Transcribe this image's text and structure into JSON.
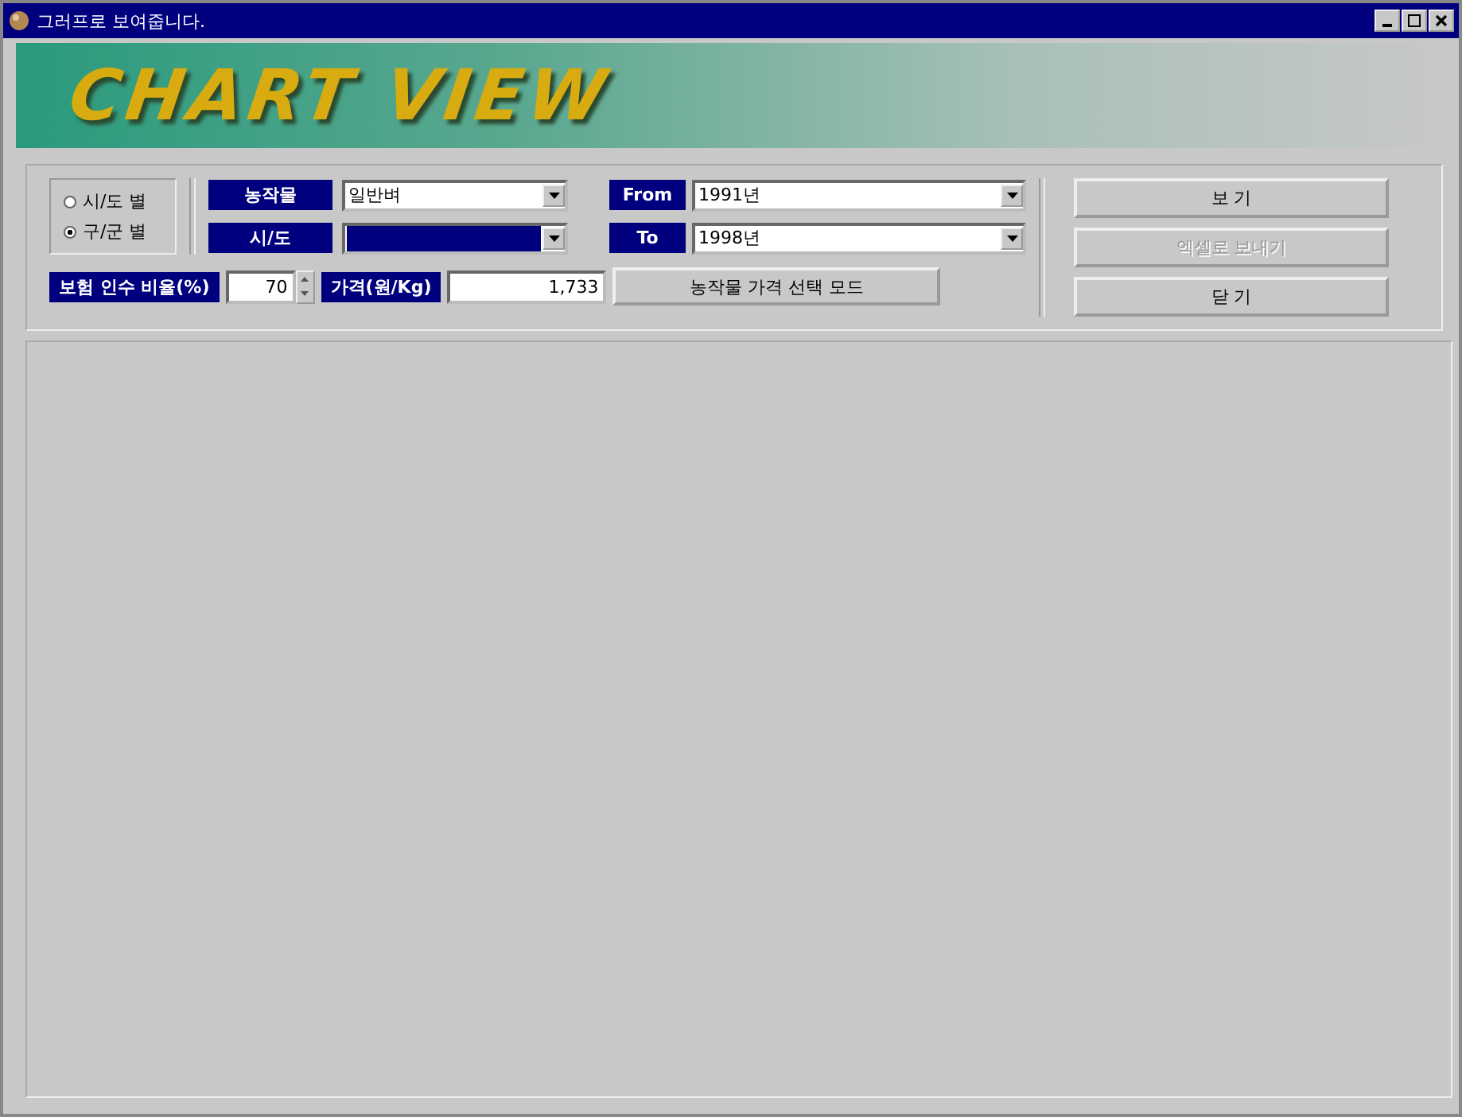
{
  "window": {
    "title": "그러프로 보여줍니다."
  },
  "banner": {
    "title": "CHART VIEW"
  },
  "mode_options": [
    {
      "label": "시/도 별",
      "selected": false
    },
    {
      "label": "구/군 별",
      "selected": true
    }
  ],
  "crop": {
    "label": "농작물",
    "value": "일반벼"
  },
  "region": {
    "label": "시/도"
  },
  "from": {
    "label": "From",
    "value": "1991년"
  },
  "to": {
    "label": "To",
    "value": "1998년"
  },
  "ratio": {
    "label": "보험 인수 비율(%)",
    "value": "70"
  },
  "price": {
    "label": "가격(원/Kg)",
    "value": "1,733"
  },
  "price_mode_button": "농작물 가격 선택 모드",
  "buttons": [
    {
      "label": "보  기",
      "disabled": false
    },
    {
      "label": "엑셀로 보내기",
      "disabled": true
    },
    {
      "label": "닫  기",
      "disabled": false
    }
  ]
}
